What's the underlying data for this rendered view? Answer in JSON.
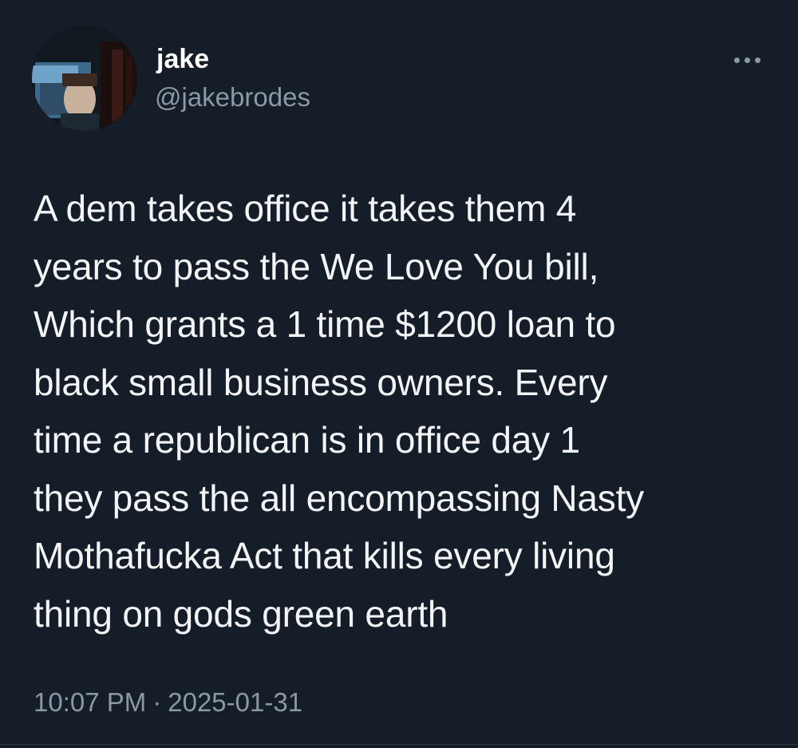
{
  "user": {
    "display_name": "jake",
    "handle": "@jakebrodes"
  },
  "tweet": {
    "text": "A dem takes office it takes them 4\nyears to pass the We Love You bill,\nWhich grants a 1 time $1200 loan to\nblack small business owners. Every\ntime a republican is in office day 1\nthey pass the all encompassing Nasty\nMothafucka Act that kills every living\nthing on gods green earth",
    "time": "10:07 PM",
    "separator": "·",
    "date": "2025-01-31"
  },
  "icons": {
    "more": "more-horizontal-icon"
  },
  "colors": {
    "background": "#151d28",
    "text": "#f2f4f5",
    "secondary_text": "#8b98a5"
  }
}
